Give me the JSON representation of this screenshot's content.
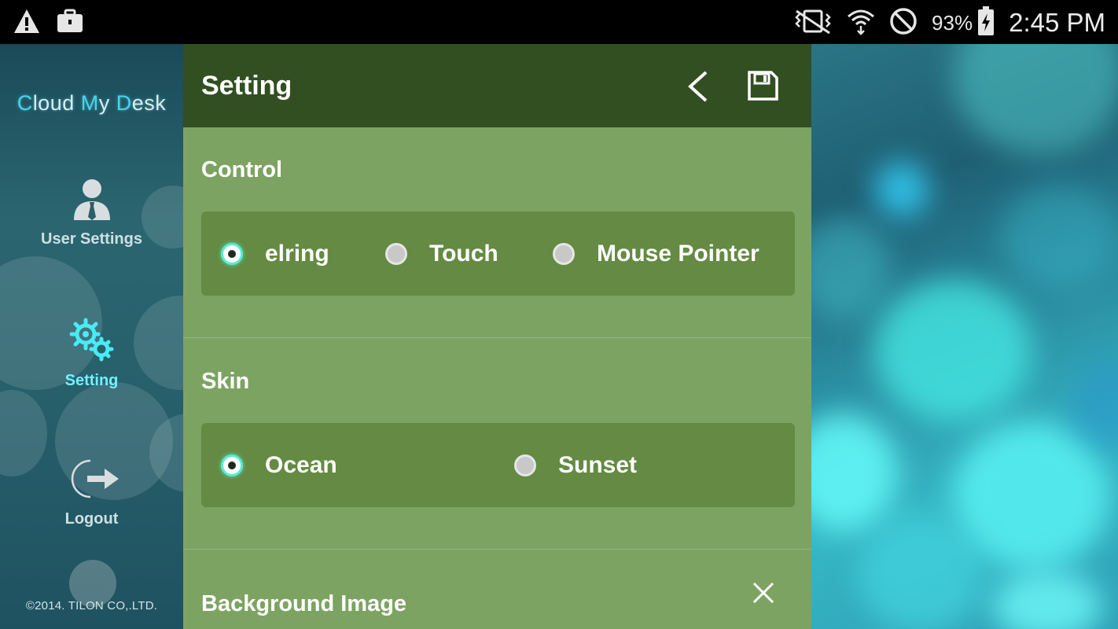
{
  "status_bar": {
    "battery_percent": "93%",
    "time": "2:45 PM",
    "icons": [
      "warning-icon",
      "briefcase-icon",
      "vibrate-mute-icon",
      "wifi-icon",
      "do-not-disturb-icon",
      "battery-charging-icon"
    ]
  },
  "sidebar": {
    "logo": {
      "part1": "C",
      "part2": "loud ",
      "part3": "M",
      "part4": "y ",
      "part5": "D",
      "part6": "esk"
    },
    "items": [
      {
        "label": "User Settings",
        "icon": "user-icon",
        "active": false
      },
      {
        "label": "Setting",
        "icon": "gears-icon",
        "active": true
      },
      {
        "label": "Logout",
        "icon": "logout-icon",
        "active": false
      }
    ],
    "copyright": "©2014. TILON CO,.LTD."
  },
  "panel": {
    "title": "Setting",
    "header_icons": [
      "back-icon",
      "save-icon"
    ],
    "sections": {
      "control": {
        "title": "Control",
        "options": [
          "elring",
          "Touch",
          "Mouse Pointer"
        ],
        "selected": "elring"
      },
      "skin": {
        "title": "Skin",
        "options": [
          "Ocean",
          "Sunset"
        ],
        "selected": "Ocean"
      },
      "background": {
        "title": "Background Image"
      }
    }
  },
  "colors": {
    "header": "#324f21",
    "panel": "#7da362",
    "option_box": "#648a43",
    "accent": "#6ff2ff"
  }
}
